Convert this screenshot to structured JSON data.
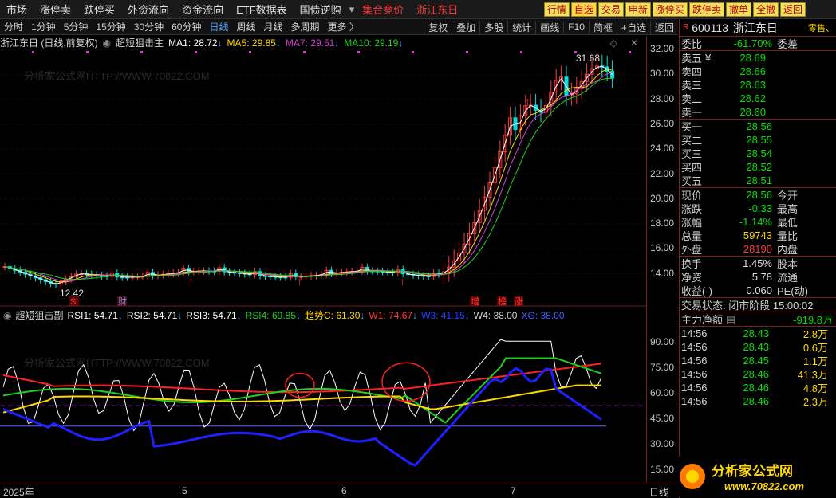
{
  "menu": [
    "市场",
    "涨停卖",
    "跌停买",
    "外资流向",
    "资金流向",
    "ETF数据表",
    "国债逆购",
    "集合竞价",
    "浙江东日"
  ],
  "menu_dropdown_icon": "chevron-down-icon",
  "top_buttons": [
    "行情",
    "自选",
    "交易",
    "申新",
    "涨停买",
    "跌停卖",
    "撤单",
    "全撤",
    "返回"
  ],
  "toolbar": {
    "periods": [
      "分时",
      "1分钟",
      "5分钟",
      "15分钟",
      "30分钟",
      "60分钟",
      "日线",
      "周线",
      "月线",
      "多周期",
      "更多 〉"
    ],
    "active": "日线",
    "tools": [
      "复权",
      "叠加",
      "多股",
      "统计",
      "画线",
      "F10",
      "简框",
      "+自选",
      "返回"
    ]
  },
  "main_header": {
    "stock": "浙江东日 (日线,前复权)",
    "indicator": "超短狙击主",
    "ma1": "MA1: 28.72",
    "ma5": "MA5: 29.85",
    "ma7": "MA7: 29.51",
    "ma10": "MA10: 29.19"
  },
  "sub_header": {
    "indicator": "超短狙击副",
    "rsi1": "RSI1: 54.71",
    "rsi2": "RSI2: 54.71",
    "rsi3": "RSI3: 54.71",
    "rsi4": "RSI4: 69.85",
    "trend": "趋势C: 61.30",
    "w1": "W1: 74.67",
    "w3": "W3: 41.15",
    "w4": "W4: 38.00",
    "xg": "XG: 38.00"
  },
  "price_axis": [
    "32.00",
    "30.00",
    "28.00",
    "26.00",
    "24.00",
    "22.00",
    "20.00",
    "18.00",
    "16.00",
    "14.00"
  ],
  "sub_axis": [
    "90.00",
    "75.00",
    "60.00",
    "45.00",
    "30.00",
    "15.00"
  ],
  "chart_labels": {
    "high": "31.68",
    "low": "12.42",
    "markers": [
      "S",
      "财",
      "增",
      "榜",
      "涨"
    ],
    "watermark": "分析家公式网HTTP://WWW.70822.COM"
  },
  "time_axis": [
    "2025年",
    "5",
    "6",
    "7"
  ],
  "bottom_label": "日线",
  "quote": {
    "code": "600113",
    "name": "浙江东日",
    "tag": "零售、",
    "ratio_label": "委比",
    "ratio": "-61.70%",
    "ratio_label2": "委差",
    "asks": [
      {
        "label": "卖五",
        "mark": "¥",
        "price": "28.69"
      },
      {
        "label": "卖四",
        "mark": "",
        "price": "28.66"
      },
      {
        "label": "卖三",
        "mark": "",
        "price": "28.63"
      },
      {
        "label": "卖二",
        "mark": "",
        "price": "28.62"
      },
      {
        "label": "卖一",
        "mark": "",
        "price": "28.60"
      }
    ],
    "bids": [
      {
        "label": "买一",
        "price": "28.56"
      },
      {
        "label": "买二",
        "price": "28.55"
      },
      {
        "label": "买三",
        "price": "28.54"
      },
      {
        "label": "买四",
        "price": "28.52"
      },
      {
        "label": "买五",
        "price": "28.51"
      }
    ],
    "stats": [
      {
        "label": "现价",
        "value": "28.56",
        "label2": "今开",
        "color": "green"
      },
      {
        "label": "涨跌",
        "value": "-0.33",
        "label2": "最高",
        "color": "green"
      },
      {
        "label": "涨幅",
        "value": "-1.14%",
        "label2": "最低",
        "color": "green"
      },
      {
        "label": "总量",
        "value": "59743",
        "label2": "量比",
        "color": "yellow"
      },
      {
        "label": "外盘",
        "value": "28190",
        "label2": "内盘",
        "color": "red"
      }
    ],
    "stats2": [
      {
        "label": "换手",
        "value": "1.45%",
        "label2": "股本"
      },
      {
        "label": "净资",
        "value": "5.78",
        "label2": "流通"
      },
      {
        "label": "收益(-)",
        "value": "0.060",
        "label2": "PE(动)"
      }
    ],
    "trade_status": "交易状态: 闭市阶段 15:00:02",
    "net_flow_label": "主力净额",
    "net_flow": "-919.8万",
    "ticks": [
      {
        "time": "14:56",
        "price": "28.43",
        "vol": "2.8万"
      },
      {
        "time": "14:56",
        "price": "28.43",
        "vol": "0.6万"
      },
      {
        "time": "14:56",
        "price": "28.45",
        "vol": "1.1万"
      },
      {
        "time": "14:56",
        "price": "28.46",
        "vol": "41.3万"
      },
      {
        "time": "14:56",
        "price": "28.46",
        "vol": "4.8万"
      },
      {
        "time": "14:56",
        "price": "28.46",
        "vol": "2.3万"
      }
    ]
  },
  "logo": {
    "text": "分析家公式网",
    "url": "www.70822.com"
  },
  "colors": {
    "up": "#ff3a3a",
    "down": "#00e0e0",
    "ma1": "#ffffff",
    "ma5": "#ffd700",
    "ma7": "#d040d0",
    "ma10": "#20d020"
  }
}
